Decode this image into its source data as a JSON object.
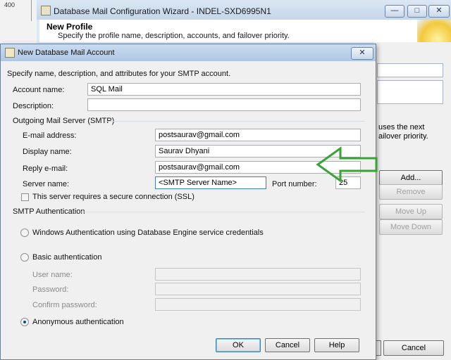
{
  "parent_wizard": {
    "ruler_label": "400",
    "title": "Database Mail Configuration Wizard - INDEL-SXD6995N1",
    "heading": "New Profile",
    "subheading": "Specify the profile name, description, accounts, and failover priority.",
    "side_text": "uses the next ailover priority.",
    "buttons": {
      "add": "Add...",
      "remove": "Remove",
      "move_up": "Move Up",
      "move_down": "Move Down",
      "cancel": "Cancel"
    },
    "caption_buttons": {
      "minimize": "—",
      "maximize": "□",
      "close": "✕"
    }
  },
  "dialog": {
    "title": "New Database Mail Account",
    "close_glyph": "✕",
    "intro": "Specify name, description, and attributes for your SMTP account.",
    "account_name_label": "Account name:",
    "account_name_value": "SQL Mail",
    "description_label": "Description:",
    "description_value": "",
    "smtp_group": "Outgoing Mail Server (SMTP)",
    "email_label": "E-mail address:",
    "email_value": "postsaurav@gmail.com",
    "display_name_label": "Display name:",
    "display_name_value": "Saurav Dhyani",
    "reply_label": "Reply e-mail:",
    "reply_value": "postsaurav@gmail.com",
    "server_label": "Server name:",
    "server_value": "<SMTP Server Name>",
    "port_label": "Port number:",
    "port_value": "25",
    "ssl_label": "This server requires a secure connection (SSL)",
    "auth_group": "SMTP Authentication",
    "auth_windows_label": "Windows Authentication using Database Engine service credentials",
    "auth_basic_label": "Basic authentication",
    "user_label": "User name:",
    "password_label": "Password:",
    "confirm_label": "Confirm password:",
    "auth_anon_label": "Anonymous authentication",
    "selected_auth": "anonymous",
    "ok": "OK",
    "cancel": "Cancel",
    "help": "Help"
  },
  "annotation": {
    "arrow_color": "#3aa335"
  }
}
